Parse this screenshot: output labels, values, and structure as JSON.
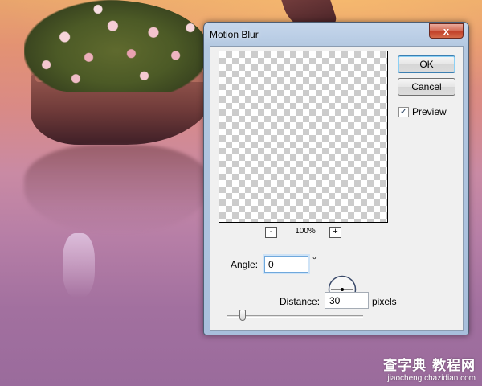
{
  "dialog": {
    "title": "Motion Blur",
    "close_glyph": "x",
    "ok_label": "OK",
    "cancel_label": "Cancel",
    "preview_label": "Preview",
    "preview_checked": true,
    "check_glyph": "✓",
    "zoom_out_glyph": "-",
    "zoom_in_glyph": "+",
    "zoom_level": "100%",
    "angle_label": "Angle:",
    "angle_value": "0",
    "degree_symbol": "°",
    "distance_label": "Distance:",
    "distance_value": "30",
    "distance_units": "pixels",
    "distance_slider_fraction": 0.12
  },
  "watermark": {
    "site_name": "查字典 教程网",
    "url": "jiaocheng.chazidian.com"
  },
  "colors": {
    "accent": "#3c7fb1",
    "close": "#c2412a"
  }
}
